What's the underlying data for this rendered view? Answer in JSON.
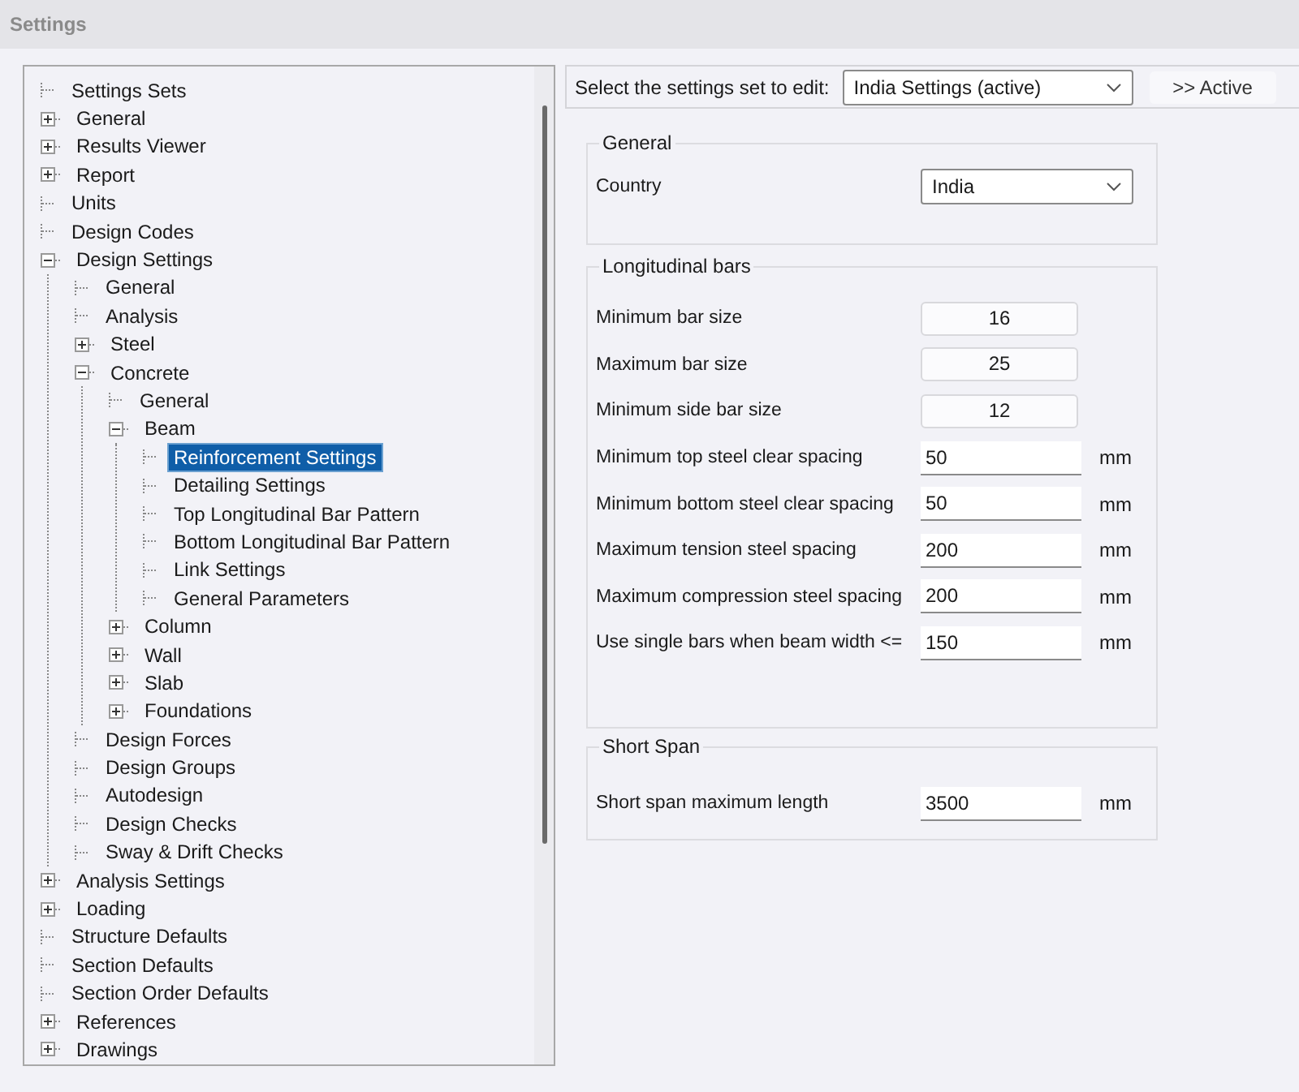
{
  "window": {
    "title": "Settings"
  },
  "tree": [
    {
      "label": "Settings Sets",
      "selected": false
    },
    {
      "label": "General",
      "selected": false,
      "expanded": false
    },
    {
      "label": "Results Viewer",
      "selected": false,
      "expanded": false
    },
    {
      "label": "Report",
      "selected": false,
      "expanded": false
    },
    {
      "label": "Units",
      "selected": false
    },
    {
      "label": "Design Codes",
      "selected": false
    },
    {
      "label": "Design Settings",
      "selected": false,
      "expanded": true,
      "children": [
        {
          "label": "General",
          "selected": false
        },
        {
          "label": "Analysis",
          "selected": false
        },
        {
          "label": "Steel",
          "selected": false,
          "expanded": false
        },
        {
          "label": "Concrete",
          "selected": false,
          "expanded": true,
          "children": [
            {
              "label": "General",
              "selected": false
            },
            {
              "label": "Beam",
              "selected": false,
              "expanded": true,
              "children": [
                {
                  "label": "Reinforcement Settings",
                  "selected": true
                },
                {
                  "label": "Detailing Settings",
                  "selected": false
                },
                {
                  "label": "Top Longitudinal Bar Pattern",
                  "selected": false
                },
                {
                  "label": "Bottom Longitudinal Bar Pattern",
                  "selected": false
                },
                {
                  "label": "Link Settings",
                  "selected": false
                },
                {
                  "label": "General Parameters",
                  "selected": false
                }
              ]
            },
            {
              "label": "Column",
              "selected": false,
              "expanded": false
            },
            {
              "label": "Wall",
              "selected": false,
              "expanded": false
            },
            {
              "label": "Slab",
              "selected": false,
              "expanded": false
            },
            {
              "label": "Foundations",
              "selected": false,
              "expanded": false
            }
          ]
        },
        {
          "label": "Design Forces",
          "selected": false
        },
        {
          "label": "Design Groups",
          "selected": false
        },
        {
          "label": "Autodesign",
          "selected": false
        },
        {
          "label": "Design Checks",
          "selected": false
        },
        {
          "label": "Sway & Drift Checks",
          "selected": false
        }
      ]
    },
    {
      "label": "Analysis Settings",
      "selected": false,
      "expanded": false
    },
    {
      "label": "Loading",
      "selected": false,
      "expanded": false
    },
    {
      "label": "Structure Defaults",
      "selected": false
    },
    {
      "label": "Section Defaults",
      "selected": false
    },
    {
      "label": "Section Order Defaults",
      "selected": false
    },
    {
      "label": "References",
      "selected": false,
      "expanded": false
    },
    {
      "label": "Drawings",
      "selected": false,
      "expanded": false
    }
  ],
  "settings_set": {
    "label": "Select the settings set to edit:",
    "value": "India Settings (active)",
    "button": ">> Active"
  },
  "groups": [
    {
      "title": "General",
      "rows": [
        {
          "kind": "dropdown",
          "label": "Country",
          "value": "India"
        }
      ]
    },
    {
      "title": "Longitudinal bars",
      "rows": [
        {
          "kind": "size",
          "label": "Minimum bar size",
          "value": "16"
        },
        {
          "kind": "size",
          "label": "Maximum bar size",
          "value": "25"
        },
        {
          "kind": "size",
          "label": "Minimum side bar size",
          "value": "12"
        },
        {
          "kind": "length",
          "label": "Minimum top steel clear spacing",
          "value": "50",
          "unit": "mm"
        },
        {
          "kind": "length",
          "label": "Minimum bottom steel clear spacing",
          "value": "50",
          "unit": "mm"
        },
        {
          "kind": "length",
          "label": "Maximum tension steel spacing",
          "value": "200",
          "unit": "mm"
        },
        {
          "kind": "length",
          "label": "Maximum compression steel spacing",
          "value": "200",
          "unit": "mm"
        },
        {
          "kind": "length",
          "label": "Use single bars when beam width <=",
          "value": "150",
          "unit": "mm"
        }
      ]
    },
    {
      "title": "Short Span",
      "rows": [
        {
          "kind": "length",
          "label": "Short span maximum length",
          "value": "3500",
          "unit": "mm"
        }
      ]
    }
  ]
}
